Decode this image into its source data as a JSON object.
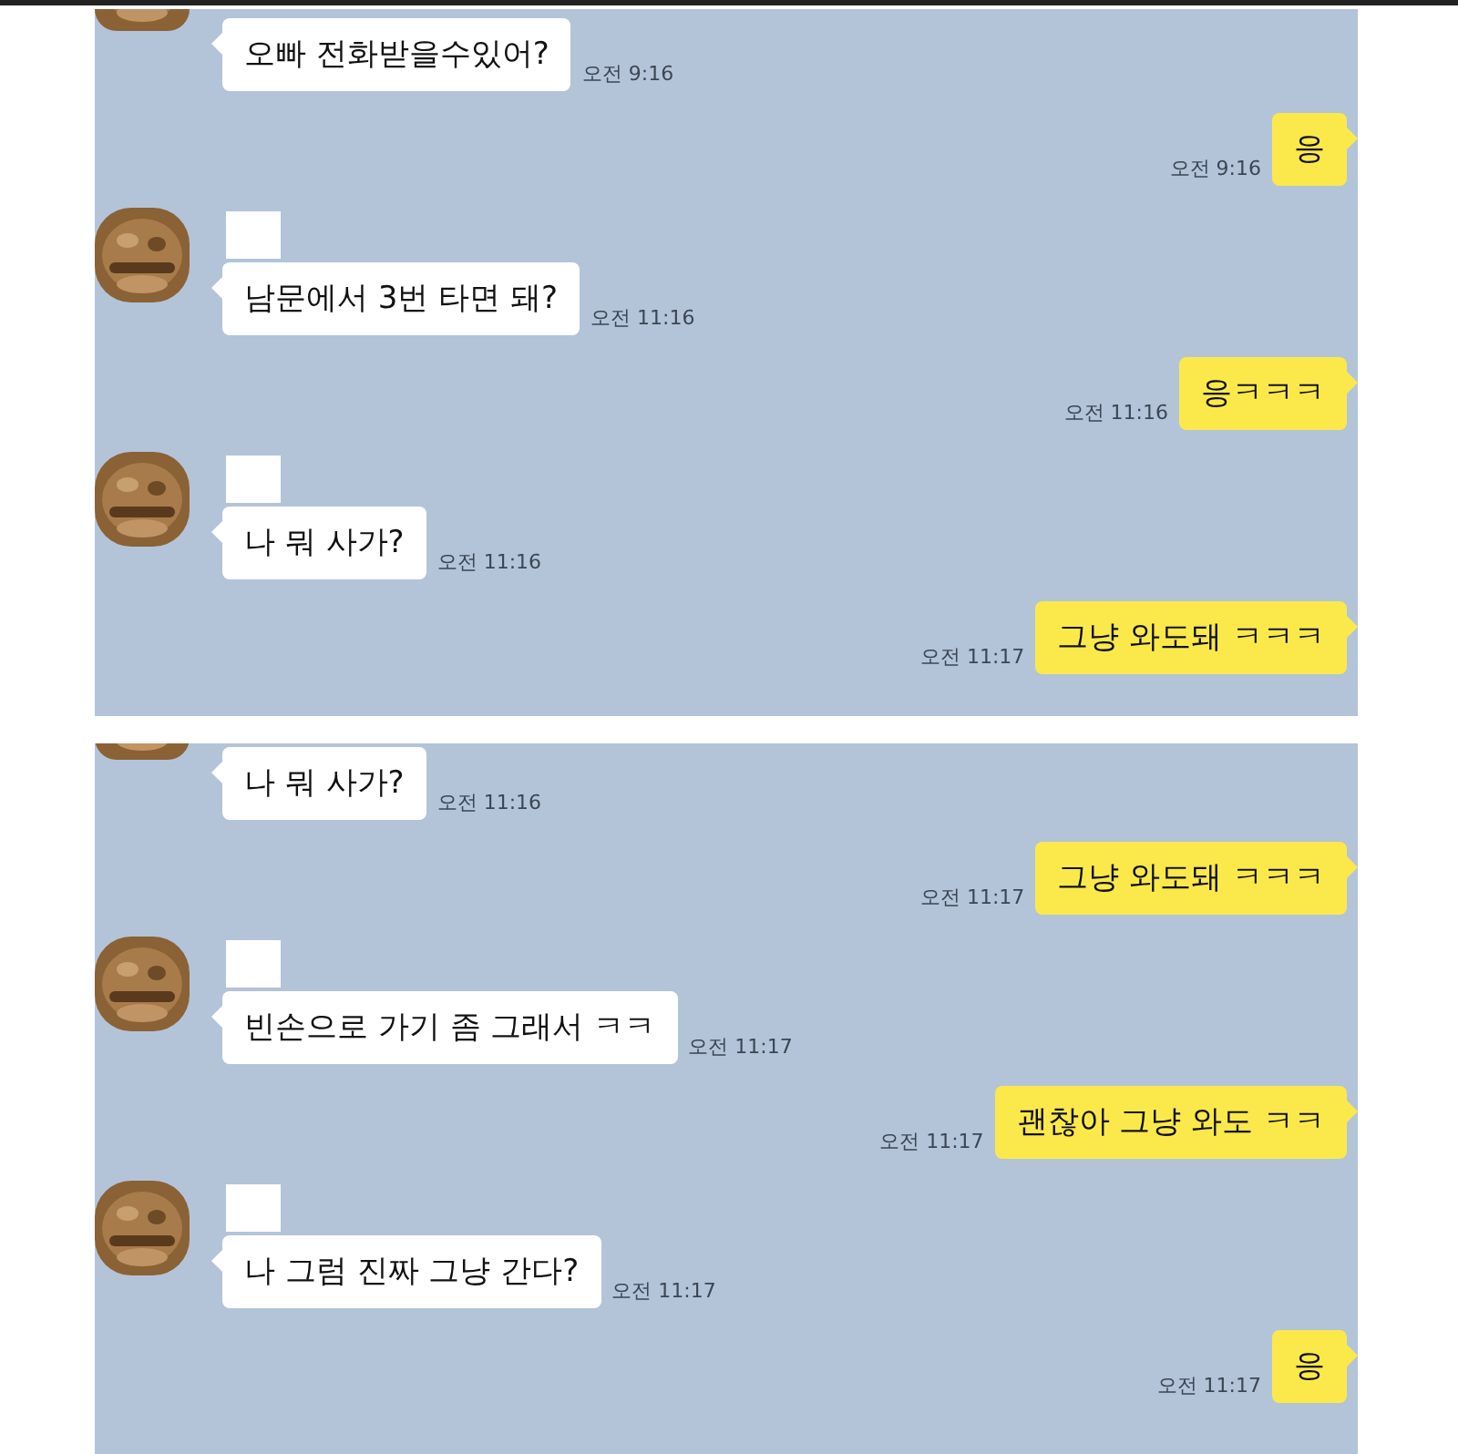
{
  "panels": [
    {
      "messages": [
        {
          "kind": "incoming",
          "avatar_clipped": true,
          "text": "오빠 전화받을수있어?",
          "time": "오전 9:16"
        },
        {
          "kind": "outgoing",
          "text": "응",
          "time": "오전 9:16"
        },
        {
          "kind": "incoming",
          "avatar_clipped": false,
          "text": "남문에서 3번 타면 돼?",
          "time": "오전 11:16"
        },
        {
          "kind": "outgoing",
          "text": "응ㅋㅋㅋ",
          "time": "오전 11:16"
        },
        {
          "kind": "incoming",
          "avatar_clipped": false,
          "text": "나 뭐 사가?",
          "time": "오전 11:16"
        },
        {
          "kind": "outgoing",
          "text": "그냥 와도돼 ㅋㅋㅋ",
          "time": "오전 11:17"
        }
      ]
    },
    {
      "messages": [
        {
          "kind": "incoming",
          "avatar_clipped": true,
          "text": "나 뭐 사가?",
          "time": "오전 11:16"
        },
        {
          "kind": "outgoing",
          "text": "그냥 와도돼 ㅋㅋㅋ",
          "time": "오전 11:17"
        },
        {
          "kind": "incoming",
          "avatar_clipped": false,
          "text": "빈손으로 가기 좀 그래서 ㅋㅋ",
          "time": "오전 11:17"
        },
        {
          "kind": "outgoing",
          "text": "괜찮아 그냥 와도 ㅋㅋ",
          "time": "오전 11:17"
        },
        {
          "kind": "incoming",
          "avatar_clipped": false,
          "text": "나 그럼 진짜 그냥 간다?",
          "time": "오전 11:17"
        },
        {
          "kind": "outgoing",
          "text": "응",
          "time": "오전 11:17"
        }
      ]
    }
  ]
}
